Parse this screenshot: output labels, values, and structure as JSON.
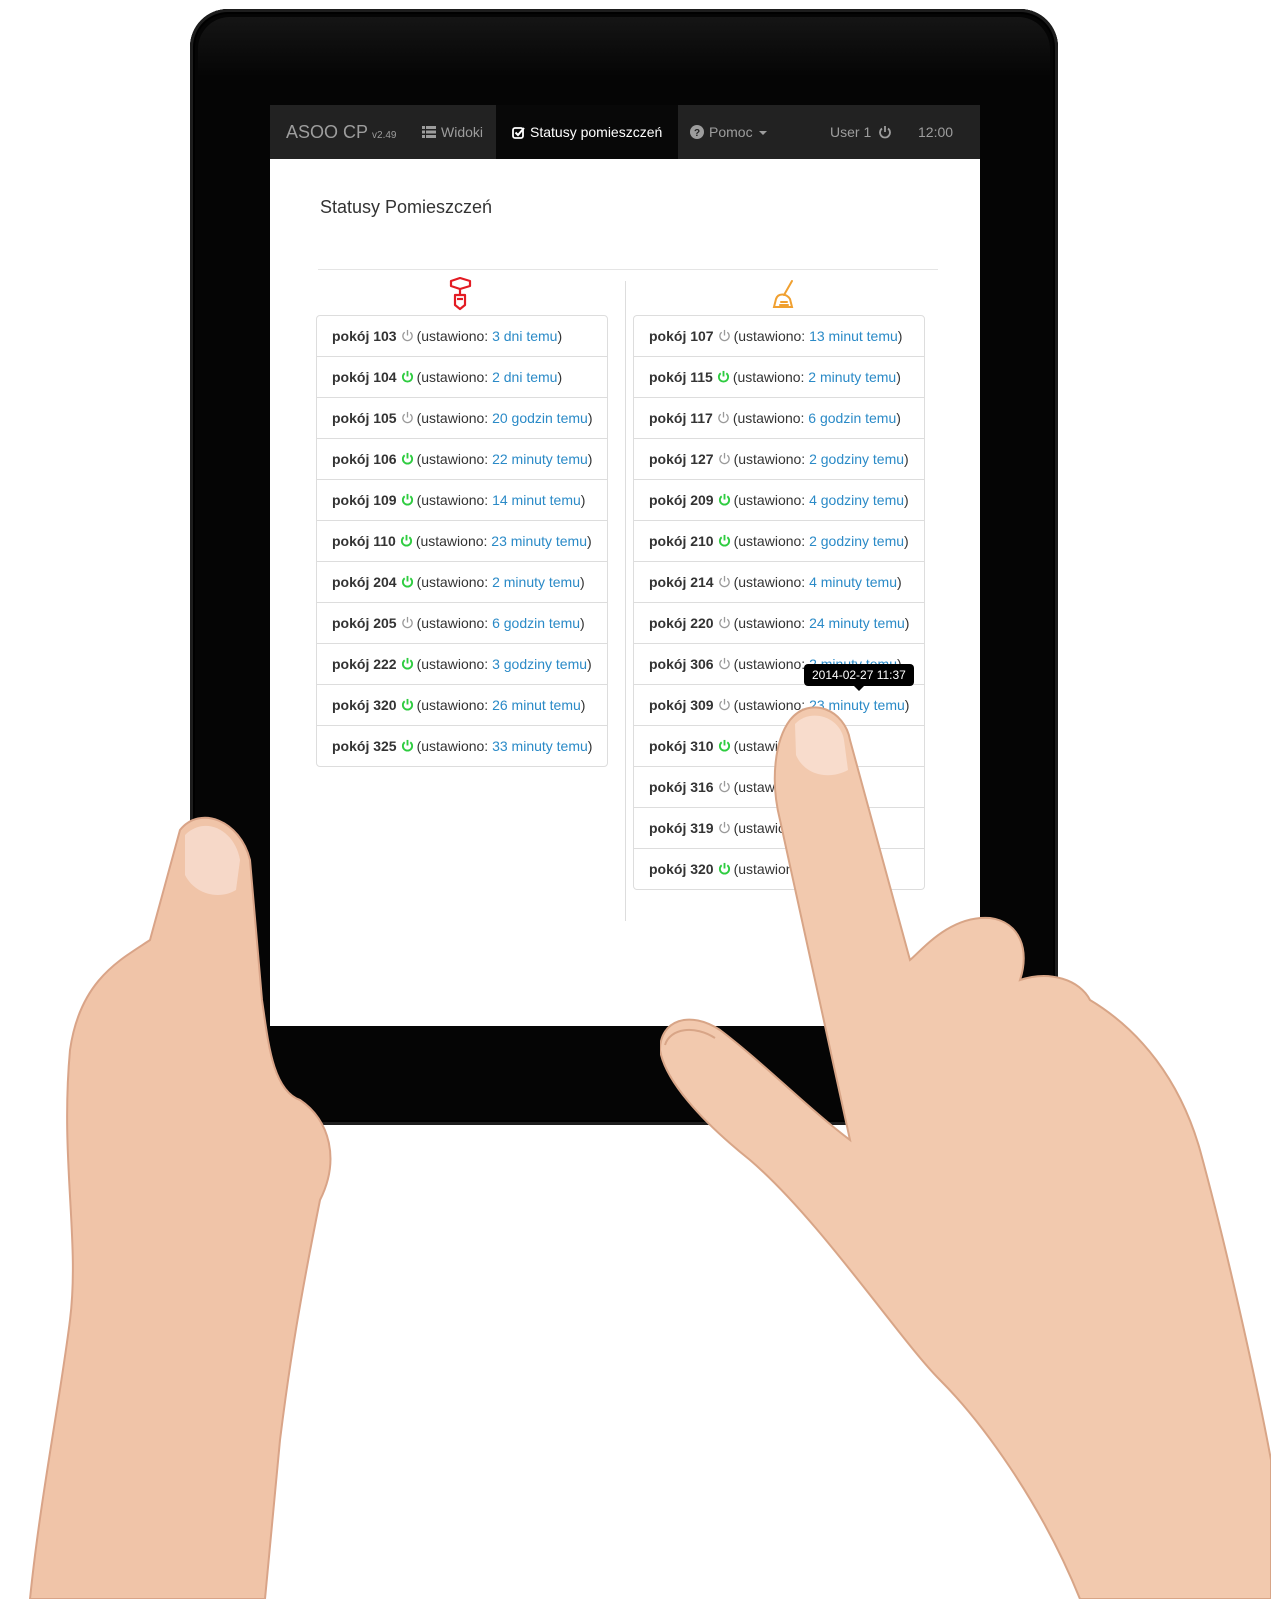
{
  "navbar": {
    "brand": "ASOO CP",
    "version": "v2.49",
    "views_label": "Widoki",
    "statuses_label": "Statusy pomieszczeń",
    "help_label": "Pomoc",
    "user_label": "User 1",
    "clock": "12:00"
  },
  "page_title": "Statusy Pomieszczeń",
  "columns": {
    "left": {
      "icon": "repair-icon",
      "icon_color": "#e31b23",
      "items": [
        {
          "room": "pokój 103",
          "on": false,
          "prefix": "(ustawiono: ",
          "time": "3 dni temu",
          "suffix": ")"
        },
        {
          "room": "pokój 104",
          "on": true,
          "prefix": "(ustawiono: ",
          "time": "2 dni temu",
          "suffix": ")"
        },
        {
          "room": "pokój 105",
          "on": false,
          "prefix": "(ustawiono: ",
          "time": "20 godzin temu",
          "suffix": ")"
        },
        {
          "room": "pokój 106",
          "on": true,
          "prefix": "(ustawiono: ",
          "time": "22 minuty temu",
          "suffix": ")"
        },
        {
          "room": "pokój 109",
          "on": true,
          "prefix": "(ustawiono: ",
          "time": "14 minut temu",
          "suffix": ")"
        },
        {
          "room": "pokój 110",
          "on": true,
          "prefix": "(ustawiono: ",
          "time": "23 minuty temu",
          "suffix": ")"
        },
        {
          "room": "pokój 204",
          "on": true,
          "prefix": "(ustawiono: ",
          "time": "2 minuty temu",
          "suffix": ")"
        },
        {
          "room": "pokój 205",
          "on": false,
          "prefix": "(ustawiono: ",
          "time": "6 godzin temu",
          "suffix": ")"
        },
        {
          "room": "pokój 222",
          "on": true,
          "prefix": "(ustawiono: ",
          "time": "3 godziny temu",
          "suffix": ")"
        },
        {
          "room": "pokój 320",
          "on": true,
          "prefix": "(ustawiono: ",
          "time": "26 minut temu",
          "suffix": ")"
        },
        {
          "room": "pokój 325",
          "on": true,
          "prefix": "(ustawiono: ",
          "time": "33 minuty temu",
          "suffix": ")"
        }
      ]
    },
    "right": {
      "icon": "cleaning-broom-icon",
      "icon_color": "#f0a030",
      "items": [
        {
          "room": "pokój 107",
          "on": false,
          "prefix": "(ustawiono: ",
          "time": "13 minut temu",
          "suffix": ")"
        },
        {
          "room": "pokój 115",
          "on": true,
          "prefix": "(ustawiono: ",
          "time": "2 minuty temu",
          "suffix": ")"
        },
        {
          "room": "pokój 117",
          "on": false,
          "prefix": "(ustawiono: ",
          "time": "6 godzin temu",
          "suffix": ")"
        },
        {
          "room": "pokój 127",
          "on": false,
          "prefix": "(ustawiono: ",
          "time": "2 godziny temu",
          "suffix": ")"
        },
        {
          "room": "pokój 209",
          "on": true,
          "prefix": "(ustawiono: ",
          "time": "4 godziny temu",
          "suffix": ")"
        },
        {
          "room": "pokój 210",
          "on": true,
          "prefix": "(ustawiono: ",
          "time": "2 godziny temu",
          "suffix": ")"
        },
        {
          "room": "pokój 214",
          "on": false,
          "prefix": "(ustawiono: ",
          "time": "4 minuty temu",
          "suffix": ")"
        },
        {
          "room": "pokój 220",
          "on": false,
          "prefix": "(ustawiono: ",
          "time": "24 minuty temu",
          "suffix": ")"
        },
        {
          "room": "pokój 306",
          "on": false,
          "prefix": "(ustawiono: ",
          "time": "2 minuty temu",
          "suffix": ")"
        },
        {
          "room": "pokój 309",
          "on": false,
          "prefix": "(ustawiono: ",
          "time": "23 minuty temu",
          "suffix": ")"
        },
        {
          "room": "pokój 310",
          "on": true,
          "prefix": "(ustawiono: ",
          "time": "",
          "suffix": ""
        },
        {
          "room": "pokój 316",
          "on": false,
          "prefix": "(ustawiono: ",
          "time": "",
          "suffix": ""
        },
        {
          "room": "pokój 319",
          "on": false,
          "prefix": "(ustawiono: ",
          "time": "",
          "suffix": ""
        },
        {
          "room": "pokój 320",
          "on": true,
          "prefix": "(ustawiono: ",
          "time": "",
          "suffix": ""
        }
      ]
    }
  },
  "tooltip": "2014-02-27 11:37",
  "colors": {
    "navbar": "#222222",
    "navbar_active": "#080808",
    "link": "#2a8ac7",
    "power_on": "#2ecc40",
    "power_off": "#999999"
  }
}
